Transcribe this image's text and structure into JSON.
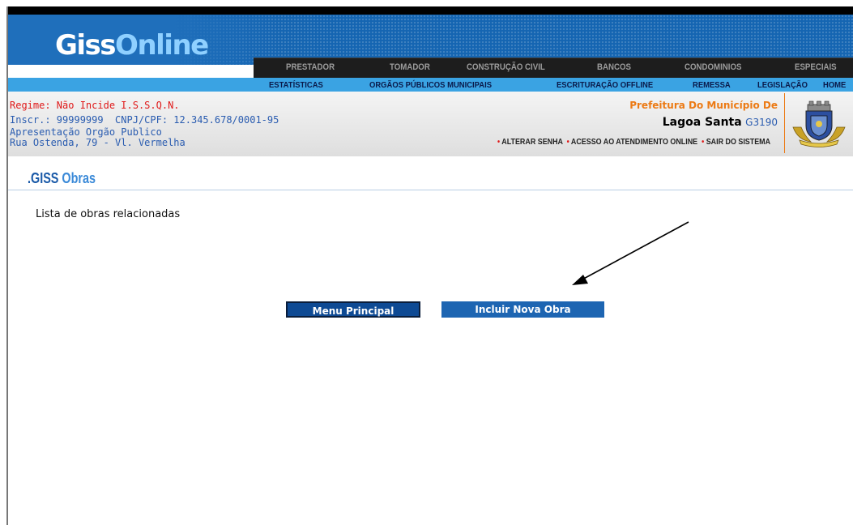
{
  "logo": {
    "part1": "Giss",
    "part2": "Online"
  },
  "nav_primary": [
    "PRESTADOR",
    "TOMADOR",
    "CONSTRUÇÃO CIVIL",
    "BANCOS",
    "CONDOMINIOS",
    "ESPECIAIS"
  ],
  "nav_secondary": [
    "ESTATÍSTICAS",
    "ORGÃOS PÚBLICOS MUNICIPAIS",
    "ESCRITURAÇÃO OFFLINE",
    "REMESSA",
    "LEGISLAÇÃO",
    "HOME"
  ],
  "user_info": {
    "regime": "Regime: Não Incide I.S.S.Q.N.",
    "inscr": "Inscr.: 99999999",
    "cnpj": "CNPJ/CPF: 12.345.678/0001-95",
    "apresentacao": "Apresentação Orgão Publico",
    "endereco": "Rua Ostenda, 79 - Vl. Vermelha"
  },
  "prefeitura": {
    "label": "Prefeitura Do Município De",
    "city": "Lagoa Santa",
    "code": "G3190"
  },
  "session_links": [
    "ALTERAR SENHA",
    "ACESSO AO ATENDIMENTO ONLINE",
    "SAIR DO SISTEMA"
  ],
  "page": {
    "title_prefix": ".GISS",
    "title_suffix": "Obras",
    "list_label": "Lista de obras relacionadas"
  },
  "buttons": {
    "menu_principal": "Menu Principal",
    "incluir_nova_obra": "Incluir Nova Obra"
  },
  "colors": {
    "brand_blue": "#1565b2",
    "nav_dark": "#1d1d1d",
    "nav_light": "#3aa3e3",
    "accent_orange": "#ec7a14",
    "alert_red": "#e01818"
  }
}
